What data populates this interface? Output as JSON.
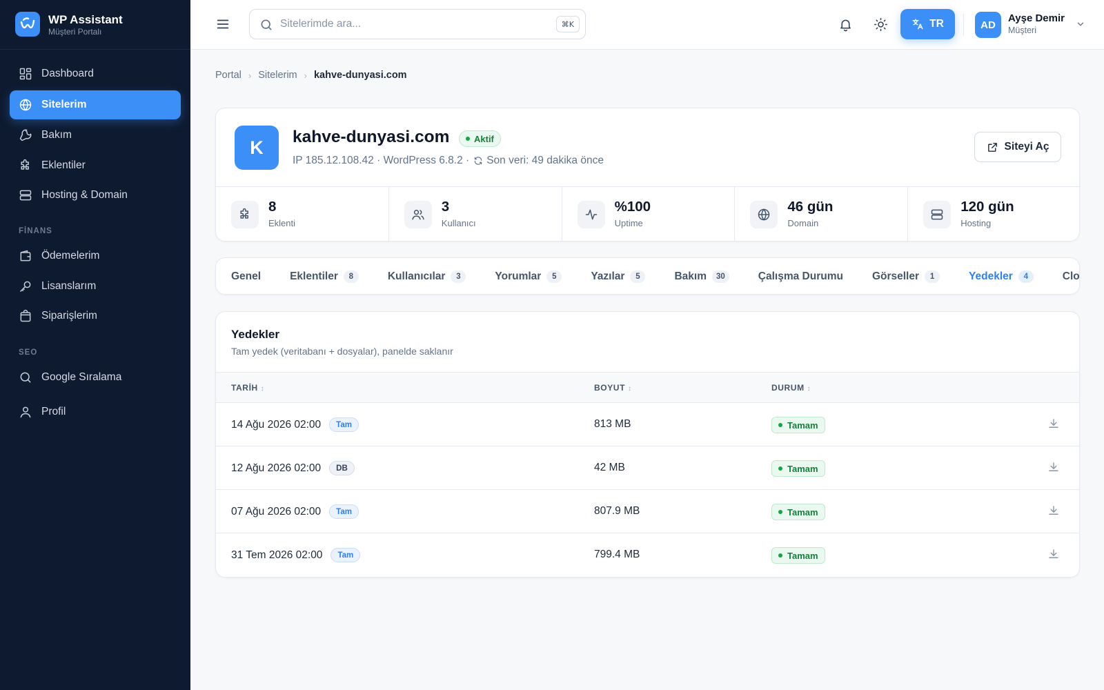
{
  "brand": {
    "name": "WP Assistant",
    "subtitle": "Müşteri Portalı"
  },
  "sidebar": {
    "items": [
      {
        "label": "Dashboard"
      },
      {
        "label": "Sitelerim"
      },
      {
        "label": "Bakım"
      },
      {
        "label": "Eklentiler"
      },
      {
        "label": "Hosting & Domain"
      }
    ],
    "finance_title": "FİNANS",
    "finance_items": [
      {
        "label": "Ödemelerim"
      },
      {
        "label": "Lisanslarım"
      },
      {
        "label": "Siparişlerim"
      }
    ],
    "seo_title": "SEO",
    "seo_items": [
      {
        "label": "Google Sıralama"
      }
    ],
    "profile_label": "Profil"
  },
  "header": {
    "search_placeholder": "Sitelerimde ara...",
    "shortcut": "⌘K",
    "language": "TR",
    "user": {
      "initials": "AD",
      "name": "Ayşe Demir",
      "role": "Müşteri"
    }
  },
  "breadcrumb": [
    "Portal",
    "Sitelerim",
    "kahve-dunyasi.com"
  ],
  "site": {
    "initial": "K",
    "domain": "kahve-dunyasi.com",
    "status": "Aktif",
    "ip": "IP 185.12.108.42",
    "wp_version": "WordPress 6.8.2",
    "last_data": "Son veri: 49 dakika önce",
    "open_label": "Siteyi Aç"
  },
  "stats": [
    {
      "value": "8",
      "label": "Eklenti",
      "icon": "puzzle-icon"
    },
    {
      "value": "3",
      "label": "Kullanıcı",
      "icon": "users-icon"
    },
    {
      "value": "%100",
      "label": "Uptime",
      "icon": "activity-icon"
    },
    {
      "value": "46 gün",
      "label": "Domain",
      "icon": "globe-icon"
    },
    {
      "value": "120 gün",
      "label": "Hosting",
      "icon": "server-icon"
    }
  ],
  "tabs": [
    {
      "label": "Genel",
      "count": ""
    },
    {
      "label": "Eklentiler",
      "count": "8"
    },
    {
      "label": "Kullanıcılar",
      "count": "3"
    },
    {
      "label": "Yorumlar",
      "count": "5"
    },
    {
      "label": "Yazılar",
      "count": "5"
    },
    {
      "label": "Bakım",
      "count": "30"
    },
    {
      "label": "Çalışma Durumu",
      "count": ""
    },
    {
      "label": "Görseller",
      "count": "1"
    },
    {
      "label": "Yedekler",
      "count": "4"
    },
    {
      "label": "Cloudflare",
      "count": ""
    }
  ],
  "active_tab": "Yedekler",
  "backups": {
    "title": "Yedekler",
    "subtitle": "Tam yedek (veritabanı + dosyalar), panelde saklanır",
    "columns": {
      "date": "TARİH",
      "size": "BOYUT",
      "status": "DURUM"
    },
    "rows": [
      {
        "date": "14 Ağu 2026 02:00",
        "type": "Tam",
        "size": "813 MB",
        "status": "Tamam"
      },
      {
        "date": "12 Ağu 2026 02:00",
        "type": "DB",
        "size": "42 MB",
        "status": "Tamam"
      },
      {
        "date": "07 Ağu 2026 02:00",
        "type": "Tam",
        "size": "807.9 MB",
        "status": "Tamam"
      },
      {
        "date": "31 Tem 2026 02:00",
        "type": "Tam",
        "size": "799.4 MB",
        "status": "Tamam"
      }
    ]
  },
  "colors": {
    "accent": "#3b8ff7",
    "sidebar_bg": "#0e1a2f",
    "success": "#16a34a"
  }
}
